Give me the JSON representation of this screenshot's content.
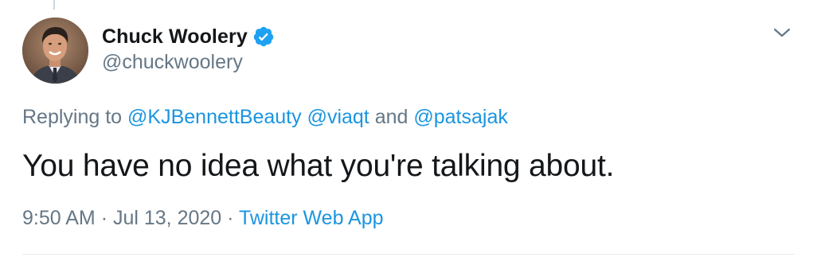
{
  "author": {
    "display_name": "Chuck Woolery",
    "handle": "@chuckwoolery",
    "verified": true
  },
  "reply": {
    "prefix": "Replying to",
    "mention_1": "@KJBennettBeauty",
    "mention_2": "@viaqt",
    "conjunction": "and",
    "mention_3": "@patsajak"
  },
  "tweet": {
    "text": "You have no idea what you're talking about."
  },
  "meta": {
    "time": "9:50 AM",
    "separator": "·",
    "date": "Jul 13, 2020",
    "source": "Twitter Web App"
  },
  "icons": {
    "verified": "verified-badge-icon",
    "more": "chevron-down-icon"
  },
  "colors": {
    "link": "#1b95e0",
    "secondary_text": "#657786",
    "primary_text": "#14171a",
    "verified": "#1da1f2"
  }
}
